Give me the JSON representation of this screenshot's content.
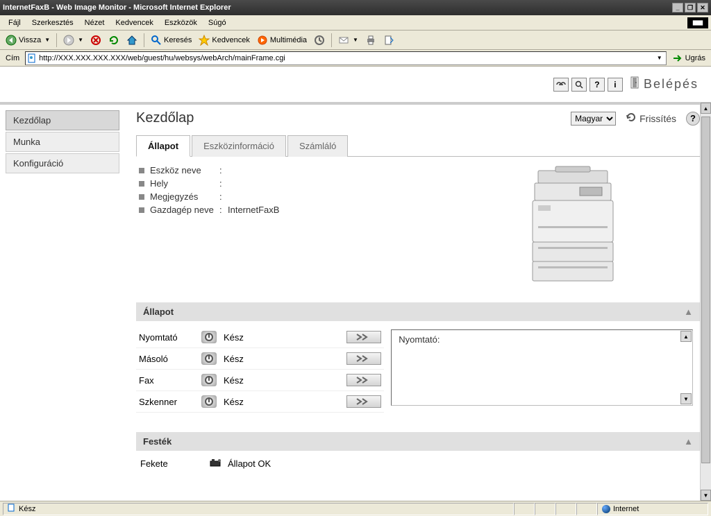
{
  "window": {
    "title": "InternetFaxB - Web Image Monitor - Microsoft Internet Explorer"
  },
  "menu": {
    "file": "Fájl",
    "edit": "Szerkesztés",
    "view": "Nézet",
    "favorites": "Kedvencek",
    "tools": "Eszközök",
    "help": "Súgó"
  },
  "toolbar": {
    "back": "Vissza",
    "search": "Keresés",
    "favorites": "Kedvencek",
    "media": "Multimédia"
  },
  "address": {
    "label": "Cím",
    "url": "http://XXX.XXX.XXX.XXX/web/guest/hu/websys/webArch/mainFrame.cgi",
    "go": "Ugrás"
  },
  "header": {
    "login": "Belépés"
  },
  "sidebar": {
    "items": [
      {
        "label": "Kezdőlap"
      },
      {
        "label": "Munka"
      },
      {
        "label": "Konfiguráció"
      }
    ]
  },
  "page": {
    "title": "Kezdőlap",
    "language": "Magyar",
    "refresh": "Frissítés"
  },
  "tabs": {
    "status": "Állapot",
    "device": "Eszközinformáció",
    "counter": "Számláló"
  },
  "device_info": {
    "name_label": "Eszköz neve",
    "name_value": "",
    "location_label": "Hely",
    "location_value": "",
    "comment_label": "Megjegyzés",
    "comment_value": "",
    "host_label": "Gazdagép neve",
    "host_value": "InternetFaxB"
  },
  "sections": {
    "status": "Állapot",
    "toner": "Festék"
  },
  "status": {
    "rows": [
      {
        "name": "Nyomtató",
        "text": "Kész"
      },
      {
        "name": "Másoló",
        "text": "Kész"
      },
      {
        "name": "Fax",
        "text": "Kész"
      },
      {
        "name": "Szkenner",
        "text": "Kész"
      }
    ],
    "panel_label": "Nyomtató:"
  },
  "toner": {
    "name": "Fekete",
    "status": "Állapot OK"
  },
  "statusbar": {
    "ready": "Kész",
    "zone": "Internet"
  }
}
